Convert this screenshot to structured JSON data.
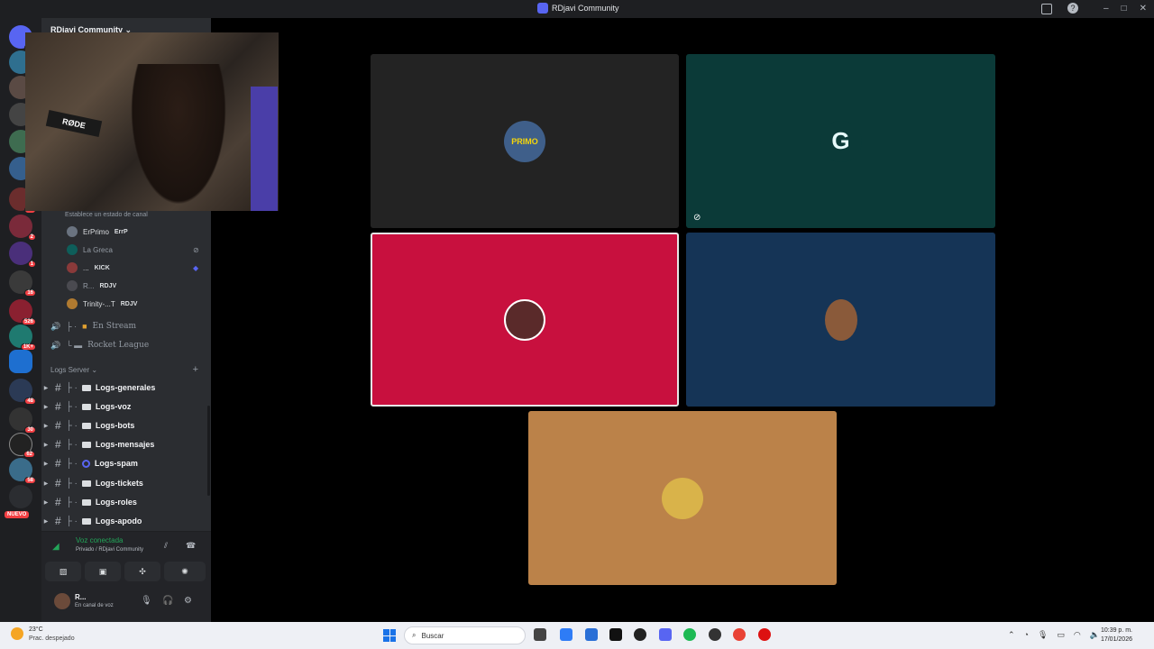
{
  "window": {
    "title": "RDjavi Community"
  },
  "server_header": {
    "name": "RDjavi Community"
  },
  "rail_badges": [
    "47",
    "74",
    "2",
    "1",
    "16",
    "526",
    "1K+",
    "48",
    "30",
    "62",
    "58"
  ],
  "rail_new": "NUEVO",
  "webcam": {
    "mic_label": "RØDE"
  },
  "channel_status_hint": "Establece un estado de canal",
  "voice_users": [
    {
      "name": "ErPrimo",
      "tag": "ErrP"
    },
    {
      "name": "La Greca",
      "tag": ""
    },
    {
      "name": "...",
      "tag": "KICK"
    },
    {
      "name": "R...",
      "tag": "RDJV"
    },
    {
      "name": "Trinity-...T",
      "tag": "RDJV"
    }
  ],
  "voice_channels": [
    "En Stream",
    "Rocket League"
  ],
  "category": {
    "name": "Logs Server"
  },
  "text_channels": [
    "Logs-generales",
    "Logs-voz",
    "Logs-bots",
    "Logs-mensajes",
    "Logs-spam",
    "Logs-tickets",
    "Logs-roles",
    "Logs-apodo"
  ],
  "voice_panel": {
    "title": "Voz conectada",
    "subtitle": "Privado / RDjavi Community"
  },
  "user_panel": {
    "name": "R...",
    "status": "En canal de voz"
  },
  "stage_tiles": [
    {
      "name": "primo-tile",
      "color": "#232323",
      "label": "PRIMO",
      "avatar_color": "#3f5f8a",
      "muted": false
    },
    {
      "name": "g-tile",
      "color": "#0b3a38",
      "label": "G",
      "avatar_color": "#0b3a38",
      "muted": true
    },
    {
      "name": "red-tile",
      "color": "#c8103e",
      "label": "",
      "avatar_color": "#5a2a2a",
      "muted": false,
      "speaking": true
    },
    {
      "name": "blue-tile",
      "color": "#153456",
      "label": "",
      "avatar_color": "#8a5a3a",
      "muted": false
    },
    {
      "name": "orange-tile",
      "color": "#bb8249",
      "label": "",
      "avatar_color": "#d9b34a",
      "muted": false
    }
  ],
  "taskbar": {
    "temperature": "23°C",
    "weather": "Prac. despejado",
    "search_placeholder": "Buscar",
    "time": "10:39 p. m.",
    "date": "17/01/2026"
  }
}
